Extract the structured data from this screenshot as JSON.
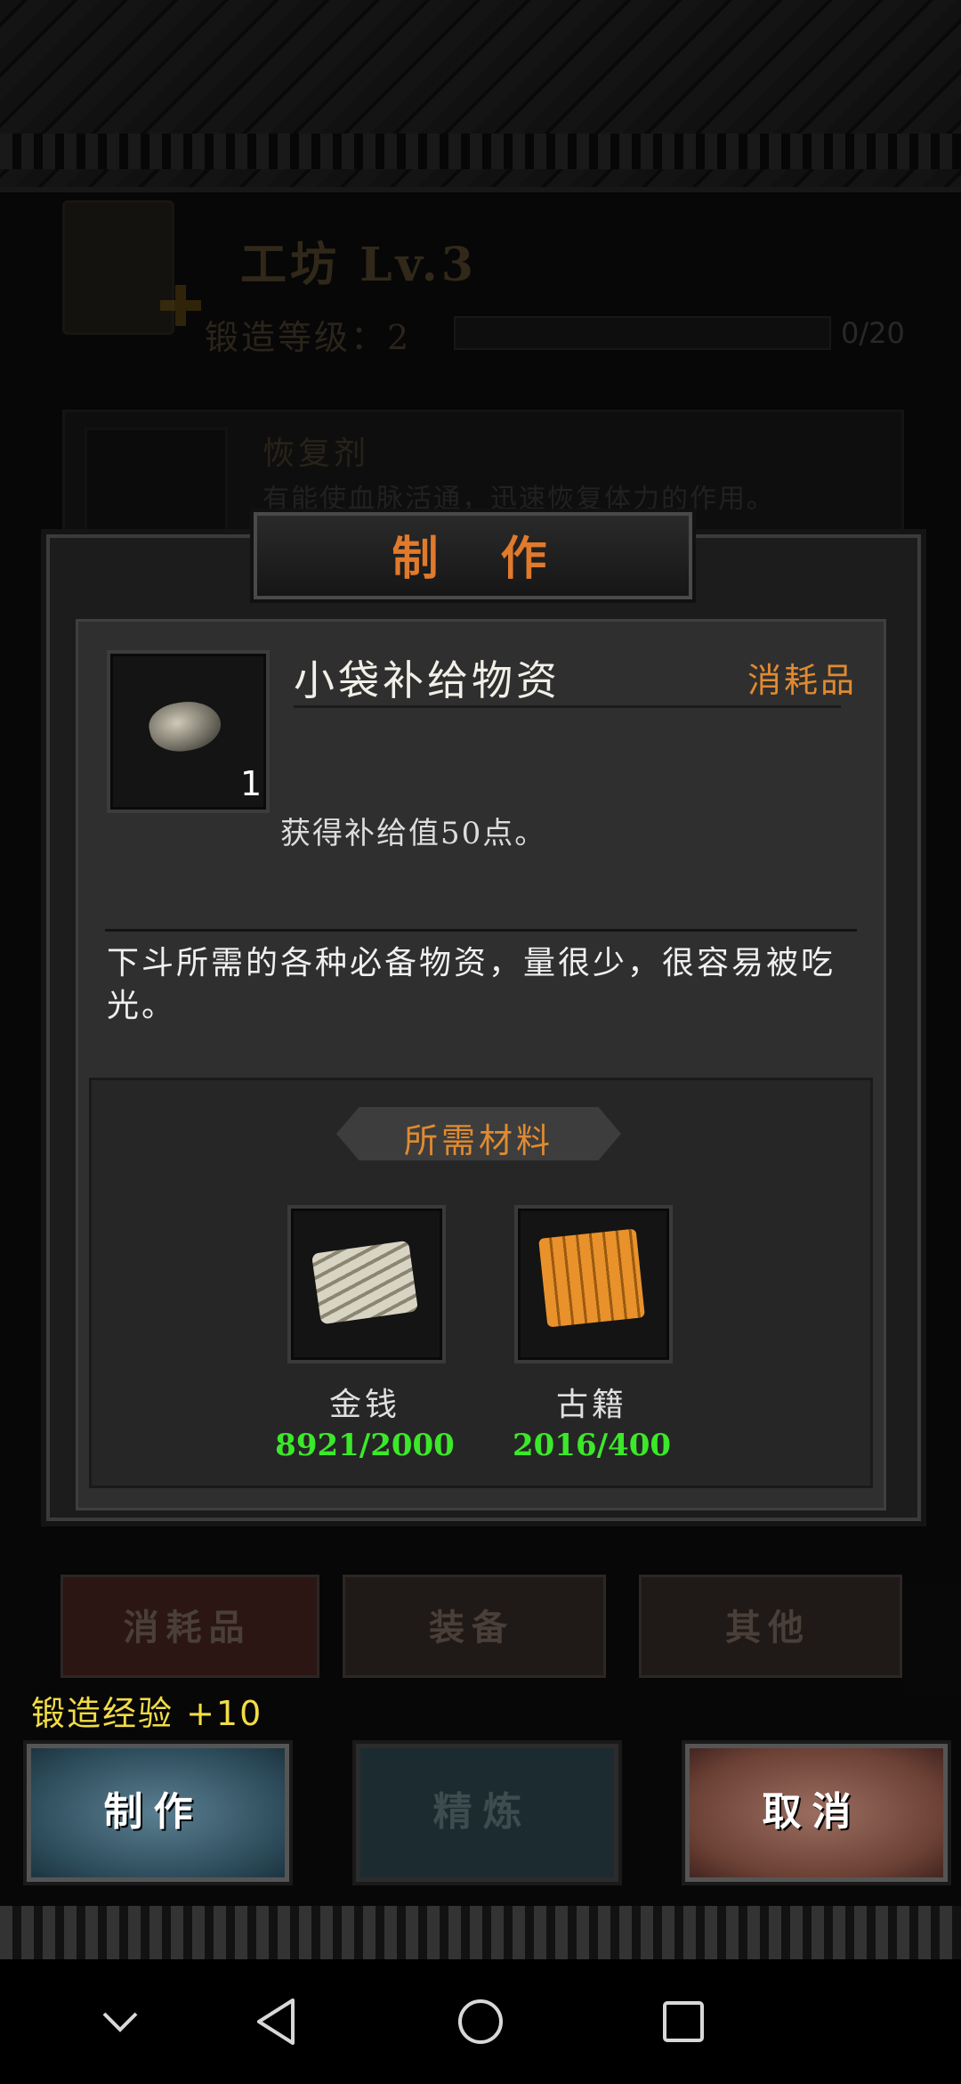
{
  "header": {
    "title": "工坊 Lv.3",
    "forge_level_label": "锻造等级：2",
    "forge_progress": "0/20",
    "forge_progress_value": 0
  },
  "background_list": {
    "item_name": "恢复剂",
    "item_desc": "有能使血脉活通，迅速恢复体力的作用。"
  },
  "dialog": {
    "title": "制作",
    "item": {
      "name": "小袋补给物资",
      "type": "消耗品",
      "quantity": "1",
      "effect": "获得补给值50点。",
      "description": "下斗所需的各种必备物资，量很少，很容易被吃光。"
    },
    "materials_header": "所需材料",
    "materials": [
      {
        "name": "金钱",
        "count": "8921/2000",
        "icon": "money-icon"
      },
      {
        "name": "古籍",
        "count": "2016/400",
        "icon": "scroll-icon"
      }
    ]
  },
  "tabs": [
    {
      "label": "消耗品"
    },
    {
      "label": "装备"
    },
    {
      "label": "其他"
    }
  ],
  "exp": "锻造经验  +10",
  "buttons": {
    "make": "制作",
    "refine": "精炼",
    "cancel": "取消"
  },
  "colors": {
    "accent_orange": "#e08a30",
    "material_ok": "#3ce82a",
    "exp_yellow": "#f2dc45"
  }
}
